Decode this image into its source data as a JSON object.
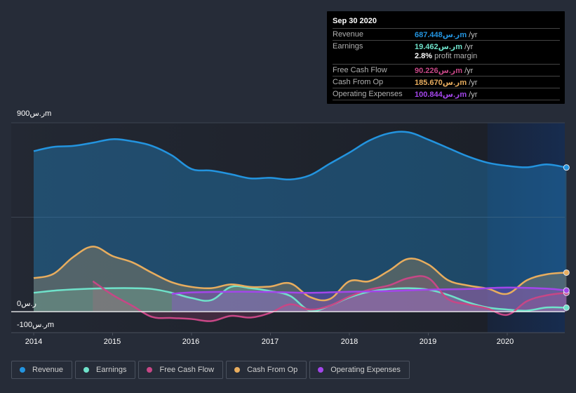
{
  "tooltip": {
    "date": "Sep 30 2020",
    "rows": [
      {
        "label": "Revenue",
        "value": "687.448ر.سm",
        "unit": " /yr",
        "color": "#2394df"
      },
      {
        "label": "Earnings",
        "value": "19.462ر.سm",
        "unit": " /yr",
        "color": "#6fe2ca"
      },
      {
        "label": "Free Cash Flow",
        "value": "90.226ر.سm",
        "unit": " /yr",
        "color": "#c74786"
      },
      {
        "label": "Cash From Op",
        "value": "185.670ر.سm",
        "unit": " /yr",
        "color": "#e8ad5e"
      },
      {
        "label": "Operating Expenses",
        "value": "100.844ر.سm",
        "unit": " /yr",
        "color": "#a346ea"
      }
    ],
    "profit_margin_value": "2.8%",
    "profit_margin_label": " profit margin"
  },
  "legend": [
    {
      "label": "Revenue",
      "color": "#2394df"
    },
    {
      "label": "Earnings",
      "color": "#6fe2ca"
    },
    {
      "label": "Free Cash Flow",
      "color": "#c74786"
    },
    {
      "label": "Cash From Op",
      "color": "#e8ad5e"
    },
    {
      "label": "Operating Expenses",
      "color": "#a346ea"
    }
  ],
  "chart_data": {
    "type": "area",
    "title": "",
    "xlabel": "",
    "ylabel": "",
    "ylim": [
      -100,
      900
    ],
    "xlim": [
      2014,
      2020.75
    ],
    "y_tick_labels": [
      {
        "value": 900,
        "label": "900ر.سm"
      },
      {
        "value": 0,
        "label": "0ر.س"
      },
      {
        "value": -100,
        "label": "-100ر.سm"
      }
    ],
    "x_tick_labels": [
      "2014",
      "2015",
      "2016",
      "2017",
      "2018",
      "2019",
      "2020"
    ],
    "x_ticks": [
      2014,
      2015,
      2016,
      2017,
      2018,
      2019,
      2020
    ],
    "forecast_region_start": 2019.75,
    "series": [
      {
        "name": "Revenue",
        "color": "#2394df",
        "x": [
          2014,
          2014.25,
          2014.5,
          2014.75,
          2015,
          2015.25,
          2015.5,
          2015.75,
          2016,
          2016.25,
          2016.5,
          2016.75,
          2017,
          2017.25,
          2017.5,
          2017.75,
          2018,
          2018.25,
          2018.5,
          2018.75,
          2019,
          2019.25,
          2019.5,
          2019.75,
          2020,
          2020.25,
          2020.5,
          2020.75
        ],
        "values": [
          765,
          785,
          790,
          805,
          822,
          812,
          790,
          745,
          680,
          672,
          655,
          635,
          638,
          630,
          650,
          705,
          758,
          815,
          850,
          855,
          820,
          780,
          740,
          710,
          695,
          688,
          702,
          687
        ]
      },
      {
        "name": "Earnings",
        "color": "#6fe2ca",
        "x": [
          2014,
          2014.25,
          2014.5,
          2014.75,
          2015,
          2015.25,
          2015.5,
          2015.75,
          2016,
          2016.25,
          2016.5,
          2016.75,
          2017,
          2017.25,
          2017.5,
          2017.75,
          2018,
          2018.25,
          2018.5,
          2018.75,
          2019,
          2019.25,
          2019.5,
          2019.75,
          2020,
          2020.25,
          2020.5,
          2020.75
        ],
        "values": [
          90,
          100,
          106,
          110,
          112,
          112,
          108,
          90,
          65,
          55,
          118,
          112,
          98,
          75,
          5,
          28,
          68,
          95,
          108,
          112,
          105,
          80,
          45,
          20,
          10,
          5,
          20,
          19
        ]
      },
      {
        "name": "Free Cash Flow",
        "color": "#c74786",
        "x": [
          2014.75,
          2015,
          2015.25,
          2015.5,
          2015.75,
          2016,
          2016.25,
          2016.5,
          2016.75,
          2017,
          2017.25,
          2017.5,
          2017.75,
          2018,
          2018.25,
          2018.5,
          2018.75,
          2019,
          2019.25,
          2019.5,
          2019.75,
          2020,
          2020.25,
          2020.5,
          2020.75
        ],
        "values": [
          145,
          80,
          28,
          -25,
          -30,
          -35,
          -45,
          -20,
          -28,
          -5,
          35,
          10,
          28,
          72,
          105,
          125,
          160,
          160,
          60,
          35,
          15,
          -15,
          50,
          78,
          90
        ]
      },
      {
        "name": "Cash From Op",
        "color": "#e8ad5e",
        "x": [
          2014,
          2014.25,
          2014.5,
          2014.75,
          2015,
          2015.25,
          2015.5,
          2015.75,
          2016,
          2016.25,
          2016.5,
          2016.75,
          2017,
          2017.25,
          2017.5,
          2017.75,
          2018,
          2018.25,
          2018.5,
          2018.75,
          2019,
          2019.25,
          2019.5,
          2019.75,
          2020,
          2020.25,
          2020.5,
          2020.75
        ],
        "values": [
          160,
          180,
          260,
          310,
          265,
          235,
          185,
          140,
          118,
          112,
          130,
          118,
          120,
          135,
          70,
          60,
          145,
          145,
          195,
          252,
          225,
          150,
          125,
          110,
          85,
          150,
          178,
          186
        ]
      },
      {
        "name": "Operating Expenses",
        "color": "#a346ea",
        "x": [
          2015.75,
          2016,
          2016.5,
          2017,
          2017.5,
          2018,
          2018.5,
          2019,
          2019.5,
          2020,
          2020.5,
          2020.75
        ],
        "values": [
          85,
          92,
          95,
          94,
          90,
          95,
          98,
          105,
          108,
          115,
          110,
          101
        ]
      }
    ]
  }
}
